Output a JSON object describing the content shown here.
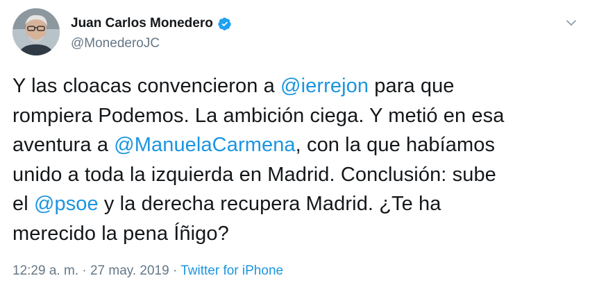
{
  "author": {
    "display_name": "Juan Carlos Monedero",
    "handle": "@MonederoJC",
    "verified": true
  },
  "icons": {
    "verified": "verified-badge-icon",
    "menu": "chevron-down-icon"
  },
  "colors": {
    "link": "#1b95e0",
    "verified": "#1da1f2",
    "secondary_text": "#657786",
    "primary_text": "#14171a"
  },
  "tweet": {
    "line1_a": "Y las cloacas convencieron a ",
    "mention1": "@ierrejon",
    "line1_b": " para que",
    "line2": "rompiera Podemos. La ambición ciega. Y metió en esa",
    "line3_a": "aventura a ",
    "mention2": "@ManuelaCarmena",
    "line3_b": ", con la que habíamos",
    "line4": "unido a toda la izquierda en Madrid. Conclusión: sube",
    "line5_a": "el ",
    "mention3": "@psoe",
    "line5_b": " y la derecha recupera Madrid. ¿Te ha",
    "line6": "merecido la pena Íñigo?"
  },
  "meta": {
    "time": "12:29 a. m.",
    "sep1": " · ",
    "date": "27 may. 2019",
    "sep2": " · ",
    "source": "Twitter for iPhone"
  }
}
